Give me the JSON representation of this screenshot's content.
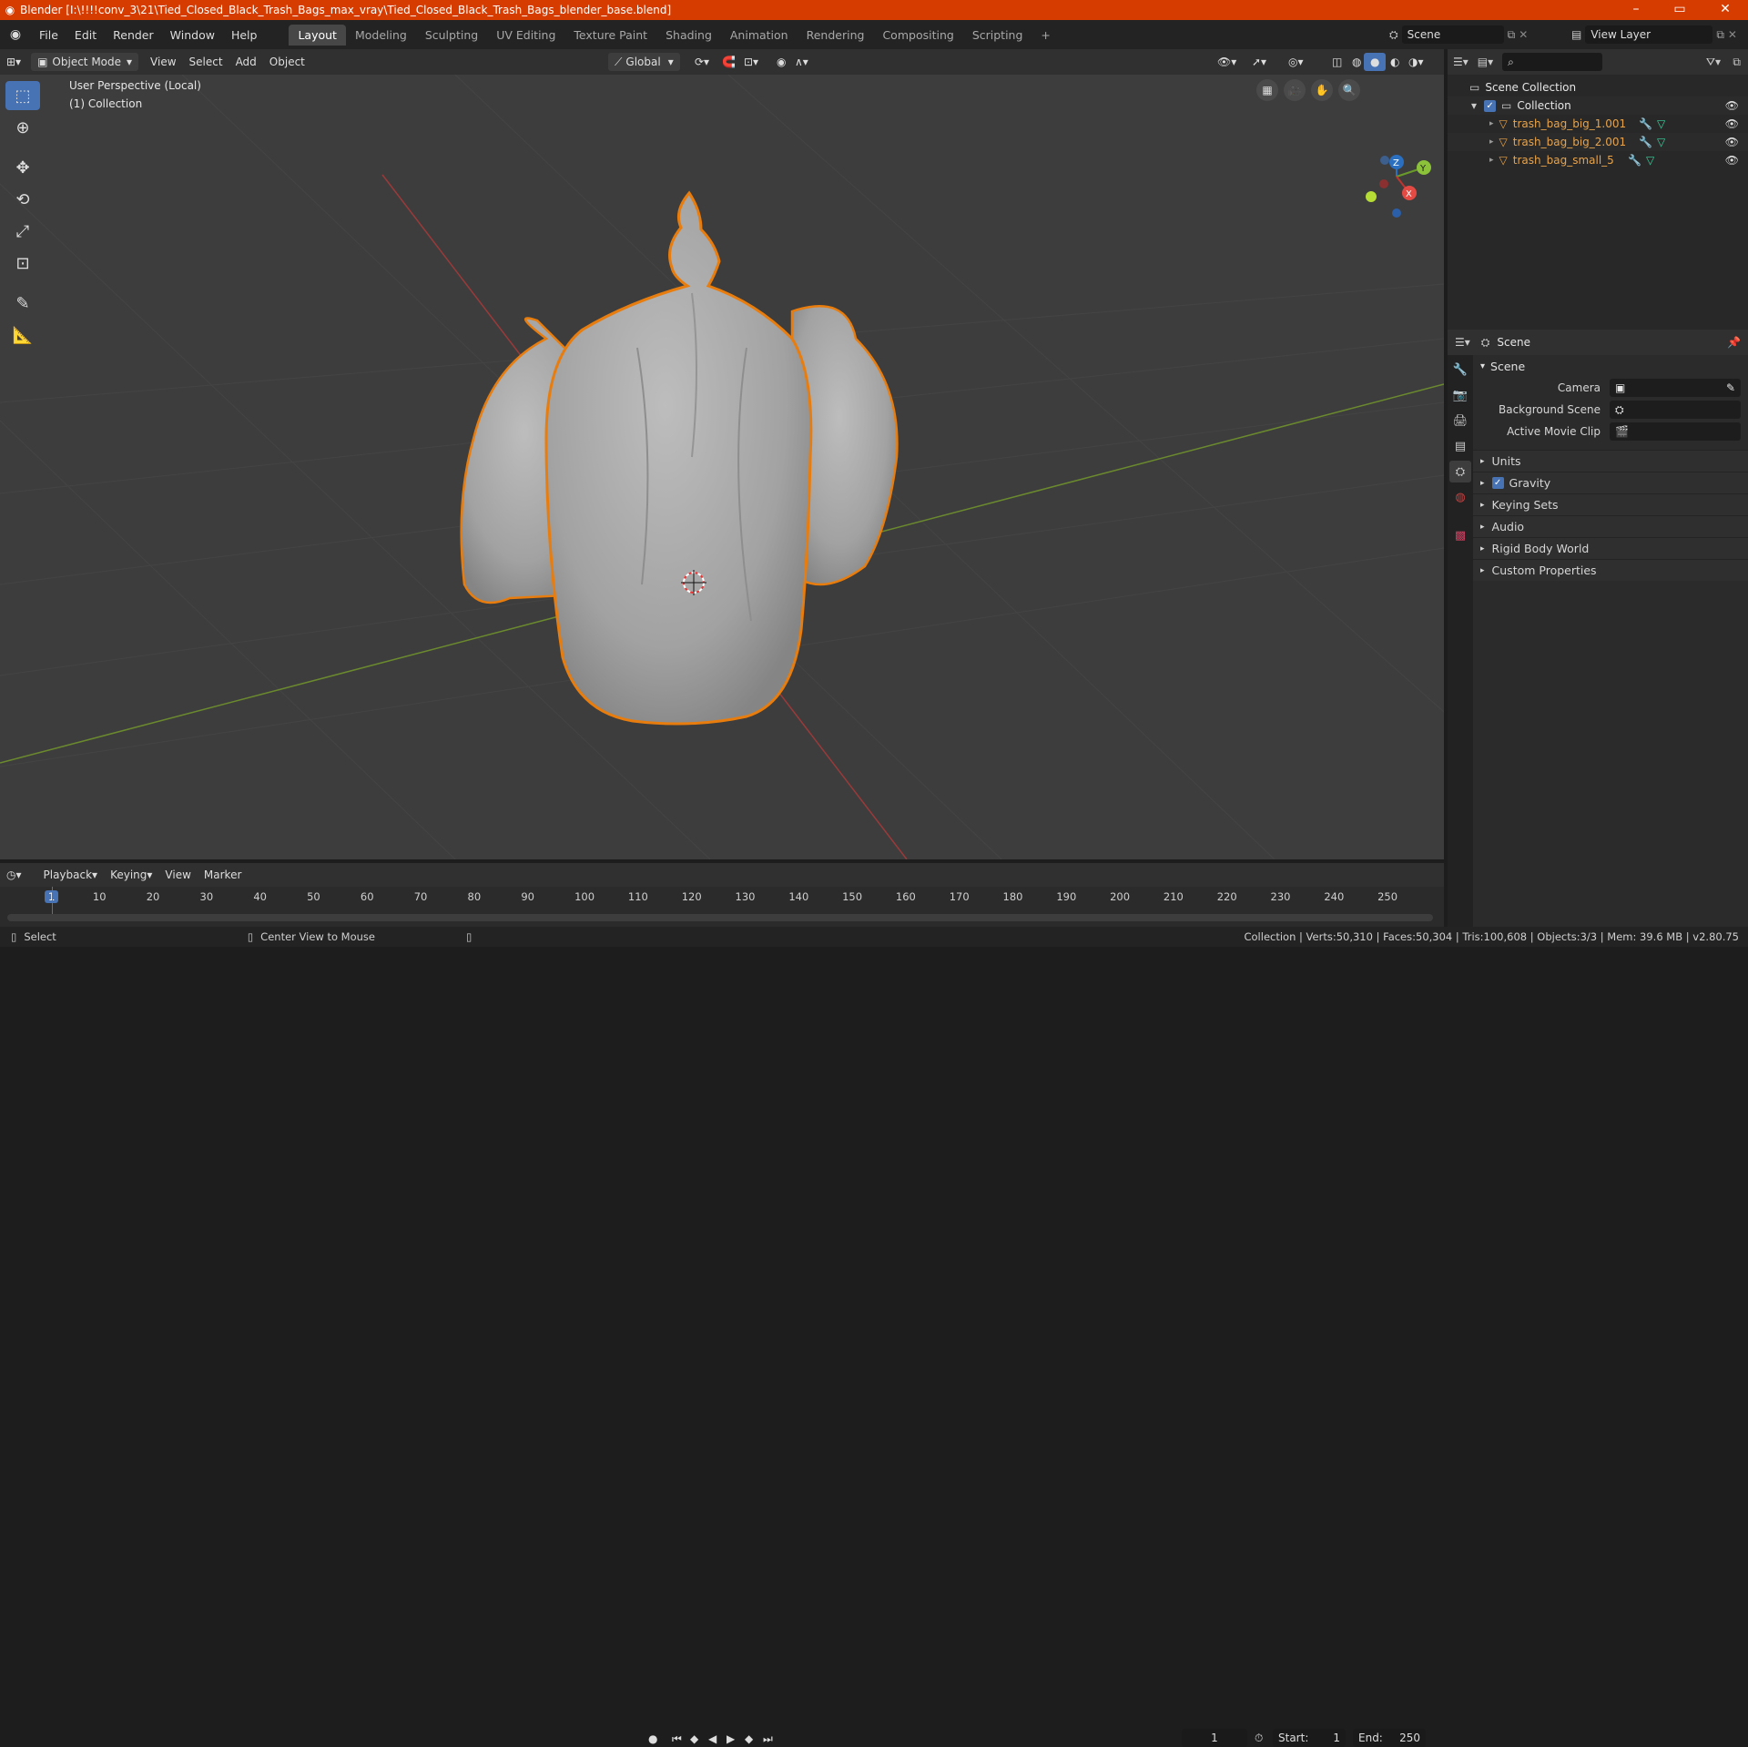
{
  "window": {
    "title": "Blender [I:\\!!!!conv_3\\21\\Tied_Closed_Black_Trash_Bags_max_vray\\Tied_Closed_Black_Trash_Bags_blender_base.blend]",
    "minimize": "–",
    "maximize": "▭",
    "close": "✕"
  },
  "menus": [
    "File",
    "Edit",
    "Render",
    "Window",
    "Help"
  ],
  "workspaces": [
    "Layout",
    "Modeling",
    "Sculpting",
    "UV Editing",
    "Texture Paint",
    "Shading",
    "Animation",
    "Rendering",
    "Compositing",
    "Scripting"
  ],
  "active_workspace": "Layout",
  "add_workspace": "+",
  "scene_selector": "Scene",
  "view_layer": "View Layer",
  "viewport_header": {
    "mode": "Object Mode",
    "menus": [
      "View",
      "Select",
      "Add",
      "Object"
    ],
    "transform_orientation": "Global"
  },
  "viewport": {
    "perspective_label": "User Perspective (Local)",
    "collection_label": "(1) Collection",
    "gizmo_axes": {
      "z": "Z",
      "y": "Y",
      "x": "X"
    }
  },
  "outliner": {
    "search_placeholder": "",
    "scene_collection": "Scene Collection",
    "collection": "Collection",
    "objects": [
      "trash_bag_big_1.001",
      "trash_bag_big_2.001",
      "trash_bag_small_5"
    ]
  },
  "properties": {
    "header_title": "Scene",
    "panel_scene": "Scene",
    "rows": [
      {
        "label": "Camera",
        "value": ""
      },
      {
        "label": "Background Scene",
        "value": ""
      },
      {
        "label": "Active Movie Clip",
        "value": ""
      }
    ],
    "collapsed_panels": [
      "Units",
      "Gravity",
      "Keying Sets",
      "Audio",
      "Rigid Body World",
      "Custom Properties"
    ]
  },
  "timeline": {
    "menus": [
      "Playback",
      "Keying",
      "View",
      "Marker"
    ],
    "current_frame": "1",
    "start_label": "Start:",
    "start": "1",
    "end_label": "End:",
    "end": "250",
    "ruler": [
      "1",
      "10",
      "20",
      "30",
      "40",
      "50",
      "60",
      "70",
      "80",
      "90",
      "100",
      "110",
      "120",
      "130",
      "140",
      "150",
      "160",
      "170",
      "180",
      "190",
      "200",
      "210",
      "220",
      "230",
      "240",
      "250"
    ]
  },
  "statusbar": {
    "left_action": "Select",
    "middle_action": "Center View to Mouse",
    "stats": "Collection | Verts:50,310 | Faces:50,304 | Tris:100,608 | Objects:3/3 | Mem: 39.6 MB | v2.80.75"
  },
  "colors": {
    "accent": "#4772b3",
    "title_bar": "#d63c00",
    "selection": "#e87d0d",
    "object_name": "#e8a34a"
  }
}
